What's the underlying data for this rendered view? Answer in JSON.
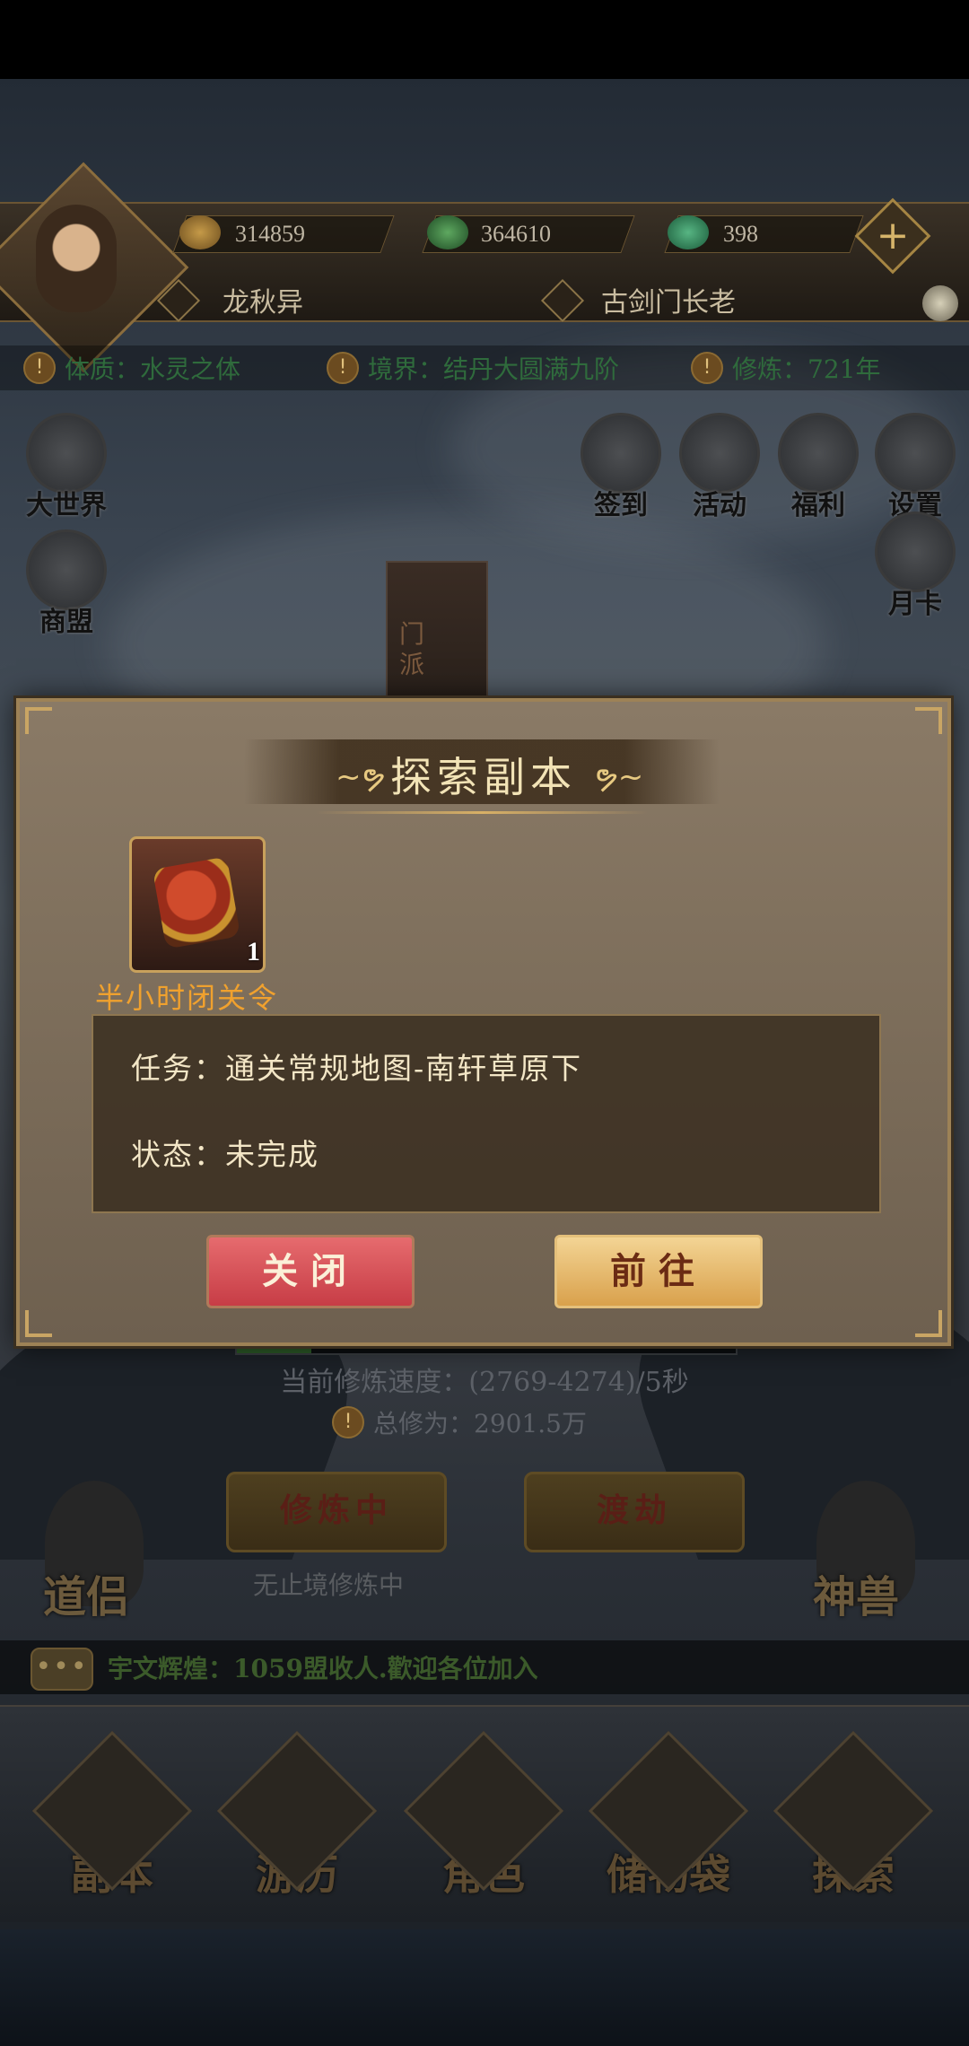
{
  "top": {
    "gold": "314859",
    "jade": "364610",
    "spirit": "398",
    "player_name": "龙秋异",
    "sect_title": "古剑门长老"
  },
  "info": {
    "physique": "体质：水灵之体",
    "realm": "境界：结丹大圆满九阶",
    "cultivation": "修炼：721年"
  },
  "side_left": [
    {
      "label": "大世界"
    },
    {
      "label": "商盟"
    }
  ],
  "side_right": [
    {
      "label": "签到"
    },
    {
      "label": "活动"
    },
    {
      "label": "福利"
    },
    {
      "label": "设置"
    },
    {
      "label": "月卡"
    }
  ],
  "pavilion_text": "门派",
  "cultivate": {
    "speed": "当前修炼速度：(2769-4274)/5秒",
    "total": "总修为：2901.5万",
    "practicing_btn": "修炼中",
    "practicing_status": "无止境修炼中",
    "tribulation_btn": "渡劫",
    "companion": "道侣",
    "beast": "神兽",
    "progress": 0.15
  },
  "chat": {
    "icon": "•••",
    "message": "宇文辉煌：1059盟收人.歡迎各位加入"
  },
  "nav": [
    {
      "label": "副本"
    },
    {
      "label": "游历"
    },
    {
      "label": "角色"
    },
    {
      "label": "储物袋"
    },
    {
      "label": "探索"
    }
  ],
  "modal": {
    "title": "探索副本",
    "reward_name": "半小时闭关令",
    "reward_qty": "1",
    "task": "任务：通关常规地图-南轩草原下",
    "status": "状态：未完成",
    "close_label": "关闭",
    "go_label": "前往"
  },
  "colors": {
    "close_button": "#d24f56",
    "go_button": "#e6b766",
    "title_text": "#f2e3b6",
    "reward_name": "#f0a12e"
  }
}
